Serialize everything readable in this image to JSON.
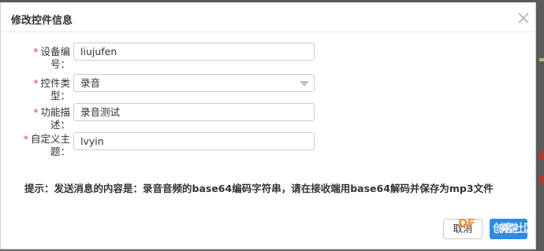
{
  "dialog": {
    "title": "修改控件信息",
    "fields": [
      {
        "required": "*",
        "label": "设备编号：",
        "value": "liujufen"
      },
      {
        "required": "*",
        "label": "控件类型：",
        "value": "录音"
      },
      {
        "required": "*",
        "label": "功能描述：",
        "value": "录音测试"
      },
      {
        "required": "*",
        "label": "自定义主题：",
        "value": "lvyin"
      }
    ],
    "hint": "提示：发送消息的内容是：录音音频的base64编码字符串，请在接收端用base64解码并保存为mp3文件",
    "cancel_label": "取消",
    "ok_label": "确定"
  },
  "watermark": {
    "logo": "DF",
    "text": "创客社区"
  },
  "colors": {
    "primary": "#2e8ae6",
    "required": "#e04040"
  },
  "icons": {
    "close": "close-icon",
    "dropdown": "chevron-down-icon"
  }
}
